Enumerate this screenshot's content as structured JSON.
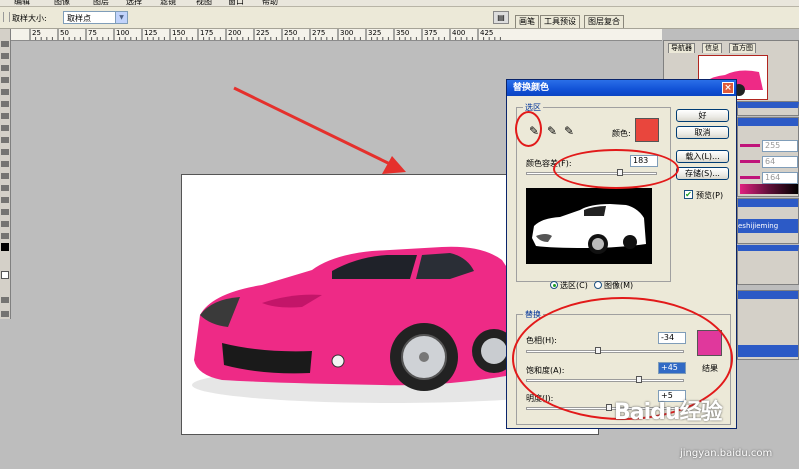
{
  "menubar": {
    "items": [
      "编辑",
      "图像",
      "图层",
      "选择",
      "滤镜",
      "视图",
      "窗口",
      "帮助"
    ]
  },
  "options": {
    "sample_size_label": "取样大小:",
    "sample_size_value": "取样点"
  },
  "window_tabs": [
    "画笔",
    "工具预设",
    "图层复合"
  ],
  "ruler_ticks": [
    "25",
    "50",
    "75",
    "100",
    "125",
    "150",
    "175",
    "200",
    "225",
    "250",
    "275",
    "300",
    "325",
    "350",
    "375",
    "400",
    "425"
  ],
  "panels": {
    "navigator": {
      "tabs": [
        "导航器",
        "信息",
        "直方图"
      ]
    },
    "color_values": [
      "255",
      "64",
      "164"
    ],
    "layer_text": "eshijieming"
  },
  "dialog": {
    "title": "替换颜色",
    "selection_group": "选区",
    "color_label": "颜色:",
    "selection_color": "#e9463d",
    "fuzziness_label": "颜色容差(F):",
    "fuzziness_value": "183",
    "fuzziness_fraction": 0.72,
    "view_selection_label": "选区(C)",
    "view_image_label": "图像(M)",
    "view_selected": "selection",
    "replace_group": "替换",
    "hue_label": "色相(H):",
    "hue_value": "-34",
    "hue_fraction": 0.45,
    "saturation_label": "饱和度(A):",
    "saturation_value": "+45",
    "saturation_fraction": 0.72,
    "lightness_label": "明度(I):",
    "lightness_value": "+5",
    "lightness_fraction": 0.52,
    "result_label": "结果",
    "result_color": "#e0389c",
    "ok_label": "好",
    "cancel_label": "取消",
    "load_label": "载入(L)...",
    "save_label": "存储(S)...",
    "preview_label": "预览(P)",
    "preview_checked": true,
    "eyedropper_icons": [
      "eyedropper-icon",
      "eyedropper-plus-icon",
      "eyedropper-minus-icon"
    ]
  },
  "canvas": {
    "car_color": "#ee2a86"
  },
  "watermark": {
    "brand": "Baidu",
    "brand_cn": "经验",
    "url": "jingyan.baidu.com"
  }
}
